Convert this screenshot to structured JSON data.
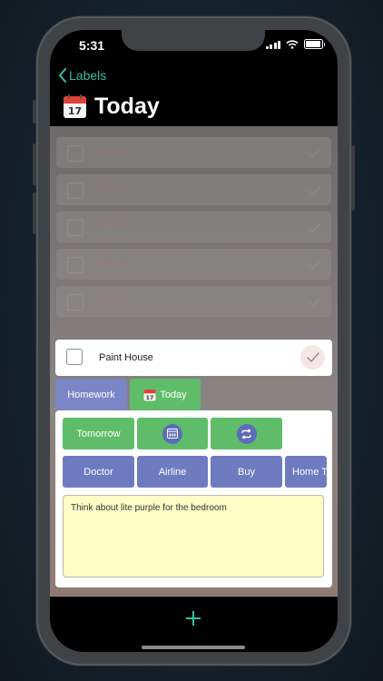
{
  "status_bar": {
    "time": "5:31"
  },
  "nav": {
    "back_label": "Labels",
    "title": "Today",
    "title_icon": "calendar-icon"
  },
  "background_list": {
    "items": [
      {
        "label": "iPhone"
      },
      {
        "label": "Airline"
      },
      {
        "label": "iPhone"
      },
      {
        "label": "iPhone"
      },
      {
        "label": "Doctor"
      }
    ]
  },
  "task": {
    "title": "Paint House",
    "done": false
  },
  "tags": [
    {
      "label": "Homework",
      "color": "#7b86c7"
    },
    {
      "label": "Today",
      "icon": "calendar-icon",
      "color": "#5fbd6a"
    }
  ],
  "actions": {
    "tomorrow_label": "Tomorrow",
    "calendar_icon": "calendar-icon",
    "repeat_icon": "repeat-icon"
  },
  "labels": [
    {
      "label": "Doctor"
    },
    {
      "label": "Airline"
    },
    {
      "label": "Buy"
    },
    {
      "label": "Home T"
    }
  ],
  "notes": {
    "text": "Think about lite purple for the bedroom"
  },
  "toolbar": {
    "add_icon": "plus-icon"
  },
  "colors": {
    "accent": "#33c1a6",
    "green": "#5fbd6a",
    "blue": "#6f7bc1",
    "notes_bg": "#fdffc6"
  }
}
